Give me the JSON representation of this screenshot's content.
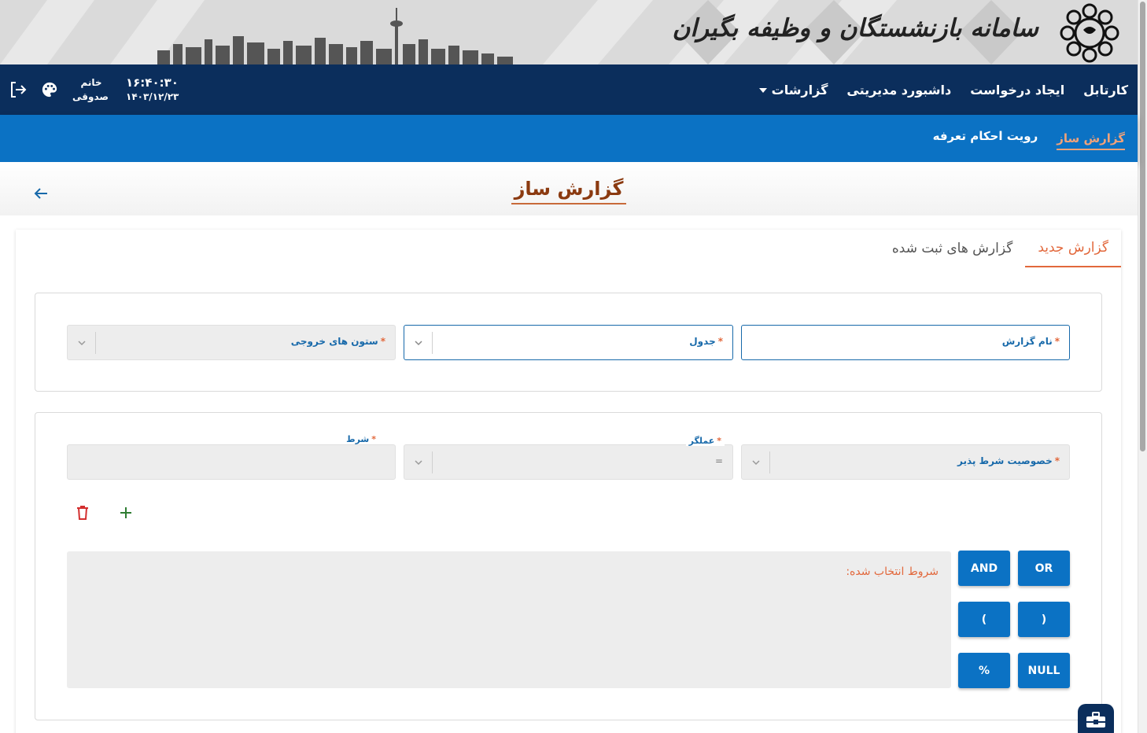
{
  "banner": {
    "title": "سامانه بازنشستگان و وظیفه بگیران",
    "logo_icon": "tehran-municipality-logo-icon",
    "skyline_icon": "city-skyline-icon"
  },
  "navbar": {
    "items": [
      "کارتابل",
      "ایجاد درخواست",
      "داشبورد مدیریتی",
      "گزارشات"
    ],
    "user_title": "خانم",
    "user_name": "صدوقی",
    "time": "۱۶:۴۰:۳۰",
    "date": "۱۴۰۳/۱۲/۲۳",
    "icons": [
      "logout-icon",
      "palette-icon",
      "caret-down-icon"
    ]
  },
  "subnav": {
    "items": [
      "گزارش ساز",
      "رویت احکام تعرفه"
    ],
    "active_index": 0
  },
  "page": {
    "title": "گزارش ساز",
    "back_icon": "arrow-left-icon"
  },
  "tabs": [
    "گزارش جدید",
    "گزارش های ثبت شده"
  ],
  "form": {
    "report_name_label": "نام گزارش",
    "table_label": "جدول",
    "output_columns_label": "ستون های خروجی",
    "condition_attr_label": "خصوصیت شرط پذیر",
    "operator_label": "عملگر",
    "operator_value": "=",
    "condition_label": "شرط",
    "required_mark": "*"
  },
  "conditions": {
    "heading": "شروط انتخاب شده:",
    "buttons": {
      "or": "OR",
      "and": "AND",
      "open_paren": "(",
      "close_paren": ")",
      "null": "NULL",
      "percent": "%"
    }
  },
  "colors": {
    "navbar": "#0b2e5c",
    "subnav": "#0b72c4",
    "accent": "#e2683c",
    "label_blue": "#1769aa",
    "delete_red": "#d32f2f",
    "add_green": "#2e7d32"
  }
}
